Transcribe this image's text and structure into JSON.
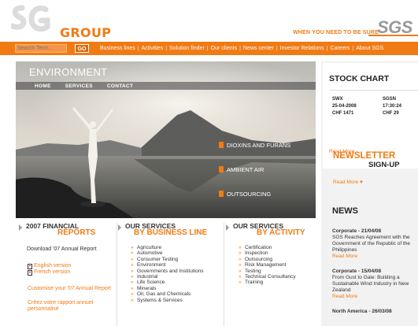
{
  "header": {
    "logo_text": "SGS",
    "logo_group": "GROUP",
    "tagline": "WHEN YOU NEED TO BE SURE",
    "brand_right": "SGS"
  },
  "search": {
    "placeholder": "Search Term...",
    "go_label": "GO"
  },
  "nav": {
    "items": [
      "Business lines",
      "Activities",
      "Solution finder",
      "Our clients",
      "News center",
      "Investor Relations",
      "Careers",
      "About SGS"
    ]
  },
  "hero": {
    "title": "ENVIRONMENT",
    "menu": [
      "HOME",
      "SERVICES",
      "CONTACT"
    ],
    "links": [
      "DIOXINS AND FURANS",
      "AMBIENT AIR",
      "OUTSOURCING"
    ]
  },
  "stock": {
    "title": "STOCK CHART",
    "rows": [
      [
        "SWX",
        "SGSN"
      ],
      [
        "25-04-2008",
        "17:30:24"
      ],
      [
        "CHF 1471",
        "CHF 29"
      ]
    ],
    "read_more": "Read More"
  },
  "newsletter": {
    "title": "NEWSLETTER",
    "signup": "SIGN-UP",
    "read_more": "Read More ♥"
  },
  "news": {
    "title": "NEWS",
    "items": [
      {
        "date": "Corporate - 21/04/08",
        "text": "SGS Reaches Agreement with the Government of the Republic of the Philippines",
        "more": "Read More"
      },
      {
        "date": "Corporate - 15/04/08",
        "text": "From Gust to Gale: Building a Sustainable Wind Industry in New Zealand",
        "more": "Read More"
      },
      {
        "date": "North America - 26/03/08",
        "text": "",
        "more": ""
      }
    ]
  },
  "financial": {
    "h1": "2007 FINANCIAL",
    "h2": "REPORTS",
    "download": "Download '07 Annual Report",
    "english": "English version",
    "french": "French version",
    "customise": "Customise your '07 Annual Report",
    "create": "Créez votre rapport annuel personnalisé"
  },
  "services_business": {
    "h1": "OUR SERVICES",
    "h2": "BY BUSINESS LINE",
    "items": [
      "Agriculture",
      "Automotive",
      "Consumer Testing",
      "Environment",
      "Governments and Institutions",
      "Industrial",
      "Life Science",
      "Minerals",
      "Oil, Gas and Chemicals",
      "Systems & Services"
    ]
  },
  "services_activity": {
    "h1": "OUR SERVICES",
    "h2": "BY ACTIVITY",
    "items": [
      "Certification",
      "Inspection",
      "Outsourcing",
      "Risk Management",
      "Testing",
      "Technical Consultancy",
      "Training"
    ]
  },
  "colors": {
    "accent": "#f07b14",
    "text": "#333333",
    "panel_bg": "#f2f2f2"
  }
}
